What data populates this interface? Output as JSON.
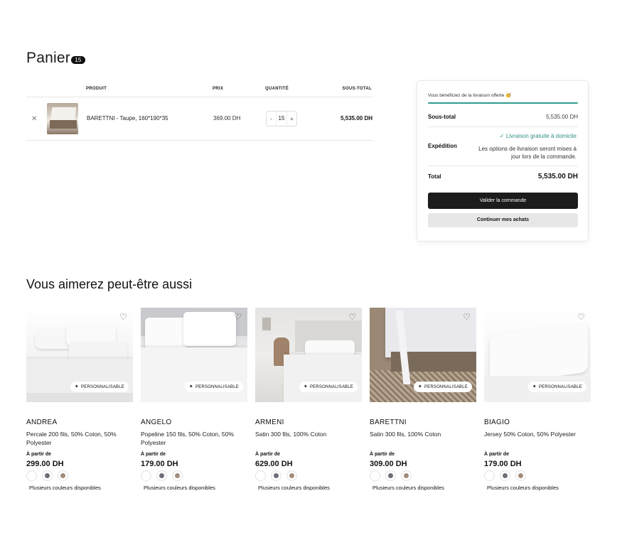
{
  "cart": {
    "title": "Panier",
    "count": "15",
    "headers": {
      "product": "PRODUIT",
      "price": "PRIX",
      "quantity": "QUANTITÉ",
      "subtotal": "SOUS-TOTAL"
    },
    "items": [
      {
        "remove_icon": "close-icon",
        "name": "BARETTNI - Taupe, 160*190*35",
        "price": "369.00 DH",
        "quantity": "15",
        "qty_minus": "-",
        "qty_plus": "+",
        "total": "5,535.00 DH"
      }
    ]
  },
  "summary": {
    "shipping_banner": "Vous bénéficiez de la livraison offerte 🥳",
    "subtotal_label": "Sous-total",
    "subtotal_value": "5,535.00 DH",
    "shipping_label": "Expédition",
    "free_shipping": "✓ Livraison gratuite à domicile",
    "shipping_note": "Les options de livraison seront mises à jour lors de la commande.",
    "total_label": "Total",
    "total_value": "5,535.00 DH",
    "checkout_button": "Valider la commande",
    "continue_button": "Continuer mes achats",
    "accent_color": "#2f9c8d"
  },
  "recommendations": {
    "title": "Vous aimerez peut-être aussi",
    "products": [
      {
        "name": "ANDREA",
        "description": "Percale 200 fils, 50% Coton, 50% Polyester",
        "from_label": "À partir de",
        "price": "299.00 DH",
        "tag": "PERSONNALISABLE",
        "more_colors": "Plusieurs couleurs disponibles"
      },
      {
        "name": "ANGELO",
        "description": "Popeline 150 fils, 50% Coton, 50% Polyester",
        "from_label": "À partir de",
        "price": "179.00 DH",
        "tag": "PERSONNALISABLE",
        "more_colors": "Plusieurs couleurs disponibles"
      },
      {
        "name": "ARMENI",
        "description": "Satin 300 fils, 100% Coton",
        "from_label": "À partir de",
        "price": "629.00 DH",
        "tag": "PERSONNALISABLE",
        "more_colors": "Plusieurs couleurs disponibles"
      },
      {
        "name": "BARETTNI",
        "description": "Satin 300 fils, 100% Coton",
        "from_label": "À partir de",
        "price": "309.00 DH",
        "tag": "PERSONNALISABLE",
        "more_colors": "Plusieurs couleurs disponibles"
      },
      {
        "name": "BIAGIO",
        "description": "Jersey 50% Coton, 50% Polyester",
        "from_label": "À partir de",
        "price": "179.00 DH",
        "tag": "PERSONNALISABLE",
        "more_colors": "Plusieurs couleurs disponibles"
      }
    ],
    "swatch_colors": [
      "#ffffff",
      "#6f6d78",
      "#a38d7a"
    ]
  }
}
